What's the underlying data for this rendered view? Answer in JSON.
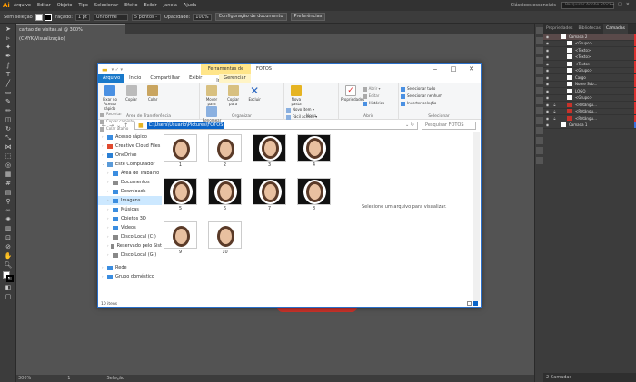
{
  "app": {
    "logo": "Ai",
    "menu": [
      "Arquivo",
      "Editar",
      "Objeto",
      "Tipo",
      "Selecionar",
      "Efeito",
      "Exibir",
      "Janela",
      "Ajuda"
    ],
    "workspace": "Clássicos essenciais",
    "search_placeholder": "Pesquisar Adobe Stock"
  },
  "control": {
    "selection": "Sem seleção",
    "stroke_label": "Traçado:",
    "stroke_value": "1 pt",
    "uniform": "Uniforme",
    "brush": "5 pontos -",
    "opacity_label": "Opacidade:",
    "opacity_value": "100%",
    "doc_config": "Configuração de documento",
    "prefs": "Preferências"
  },
  "document": {
    "tab": "cartao de visitas.ai @ 300% (CMYK/Visualização)",
    "zoom": "300%",
    "page": "1",
    "status": "Seleção"
  },
  "layers_panel": {
    "tabs": [
      "Propriedades",
      "Bibliotecas",
      "Camadas"
    ],
    "active_tab": "Camadas",
    "rows": [
      "Camada 2",
      "<Grupo>",
      "<Texto>",
      "<Texto>",
      "<Texto>",
      "<Grupo>",
      "Cargo",
      "Nome Sob...",
      "LOGO",
      "<Grupo>",
      "<Retângu...",
      "<Retângu...",
      "<Retângu...",
      "Camada 1"
    ],
    "footer": "2 Camadas"
  },
  "explorer": {
    "context_tab": "Ferramentas de Imagem",
    "title": "FOTOS",
    "ribbon_tabs": [
      "Arquivo",
      "Início",
      "Compartilhar",
      "Exibir",
      "Gerenciar"
    ],
    "groups": {
      "clipboard": {
        "label": "Área de Transferência",
        "pin": "Fixar no Acesso rápido",
        "copy": "Copiar",
        "paste": "Colar",
        "cut": "Recortar",
        "copy_path": "Copiar caminho",
        "paste_shortcut": "Colar atalho"
      },
      "organize": {
        "label": "Organizar",
        "move": "Mover para",
        "copy_to": "Copiar para",
        "delete": "Excluir",
        "rename": "Renomear"
      },
      "new": {
        "label": "Novo",
        "new_folder": "Nova pasta",
        "new_item": "Novo item",
        "easy_access": "Fácil acesso"
      },
      "open": {
        "label": "Abrir",
        "properties": "Propriedades",
        "open": "Abrir",
        "edit": "Editar",
        "history": "Histórico"
      },
      "select": {
        "label": "Selecionar",
        "all": "Selecionar tudo",
        "none": "Selecionar nenhum",
        "invert": "Inverter seleção"
      }
    },
    "path": "C:\\Users\\Usuario\\Pictures\\FOTOS",
    "search_placeholder": "Pesquisar FOTOS",
    "nav": [
      {
        "label": "Acesso rápido",
        "color": "#3b8de0"
      },
      {
        "label": "Creative Cloud Files",
        "color": "#e04a2f"
      },
      {
        "label": "OneDrive",
        "color": "#2a7fd4"
      },
      {
        "label": "Este Computador",
        "color": "#5a9ad8"
      },
      {
        "label": "Área de Trabalho",
        "color": "#3b8de0"
      },
      {
        "label": "Documentos",
        "color": "#8b8b8b"
      },
      {
        "label": "Downloads",
        "color": "#3b8de0"
      },
      {
        "label": "Imagens",
        "color": "#3b8de0"
      },
      {
        "label": "Músicas",
        "color": "#3b8de0"
      },
      {
        "label": "Objetos 3D",
        "color": "#3b8de0"
      },
      {
        "label": "Vídeos",
        "color": "#3b8de0"
      },
      {
        "label": "Disco Local (C:)",
        "color": "#888888"
      },
      {
        "label": "Reservado pelo Sist",
        "color": "#888888"
      },
      {
        "label": "Disco Local (G:)",
        "color": "#888888"
      },
      {
        "label": "Rede",
        "color": "#3b8de0"
      },
      {
        "label": "Grupo doméstico",
        "color": "#3b8de0"
      }
    ],
    "files": [
      "1",
      "2",
      "3",
      "4",
      "5",
      "6",
      "7",
      "8",
      "9",
      "10"
    ],
    "preview_text": "Selecione um arquivo para visualizar.",
    "item_count": "10 itens"
  }
}
